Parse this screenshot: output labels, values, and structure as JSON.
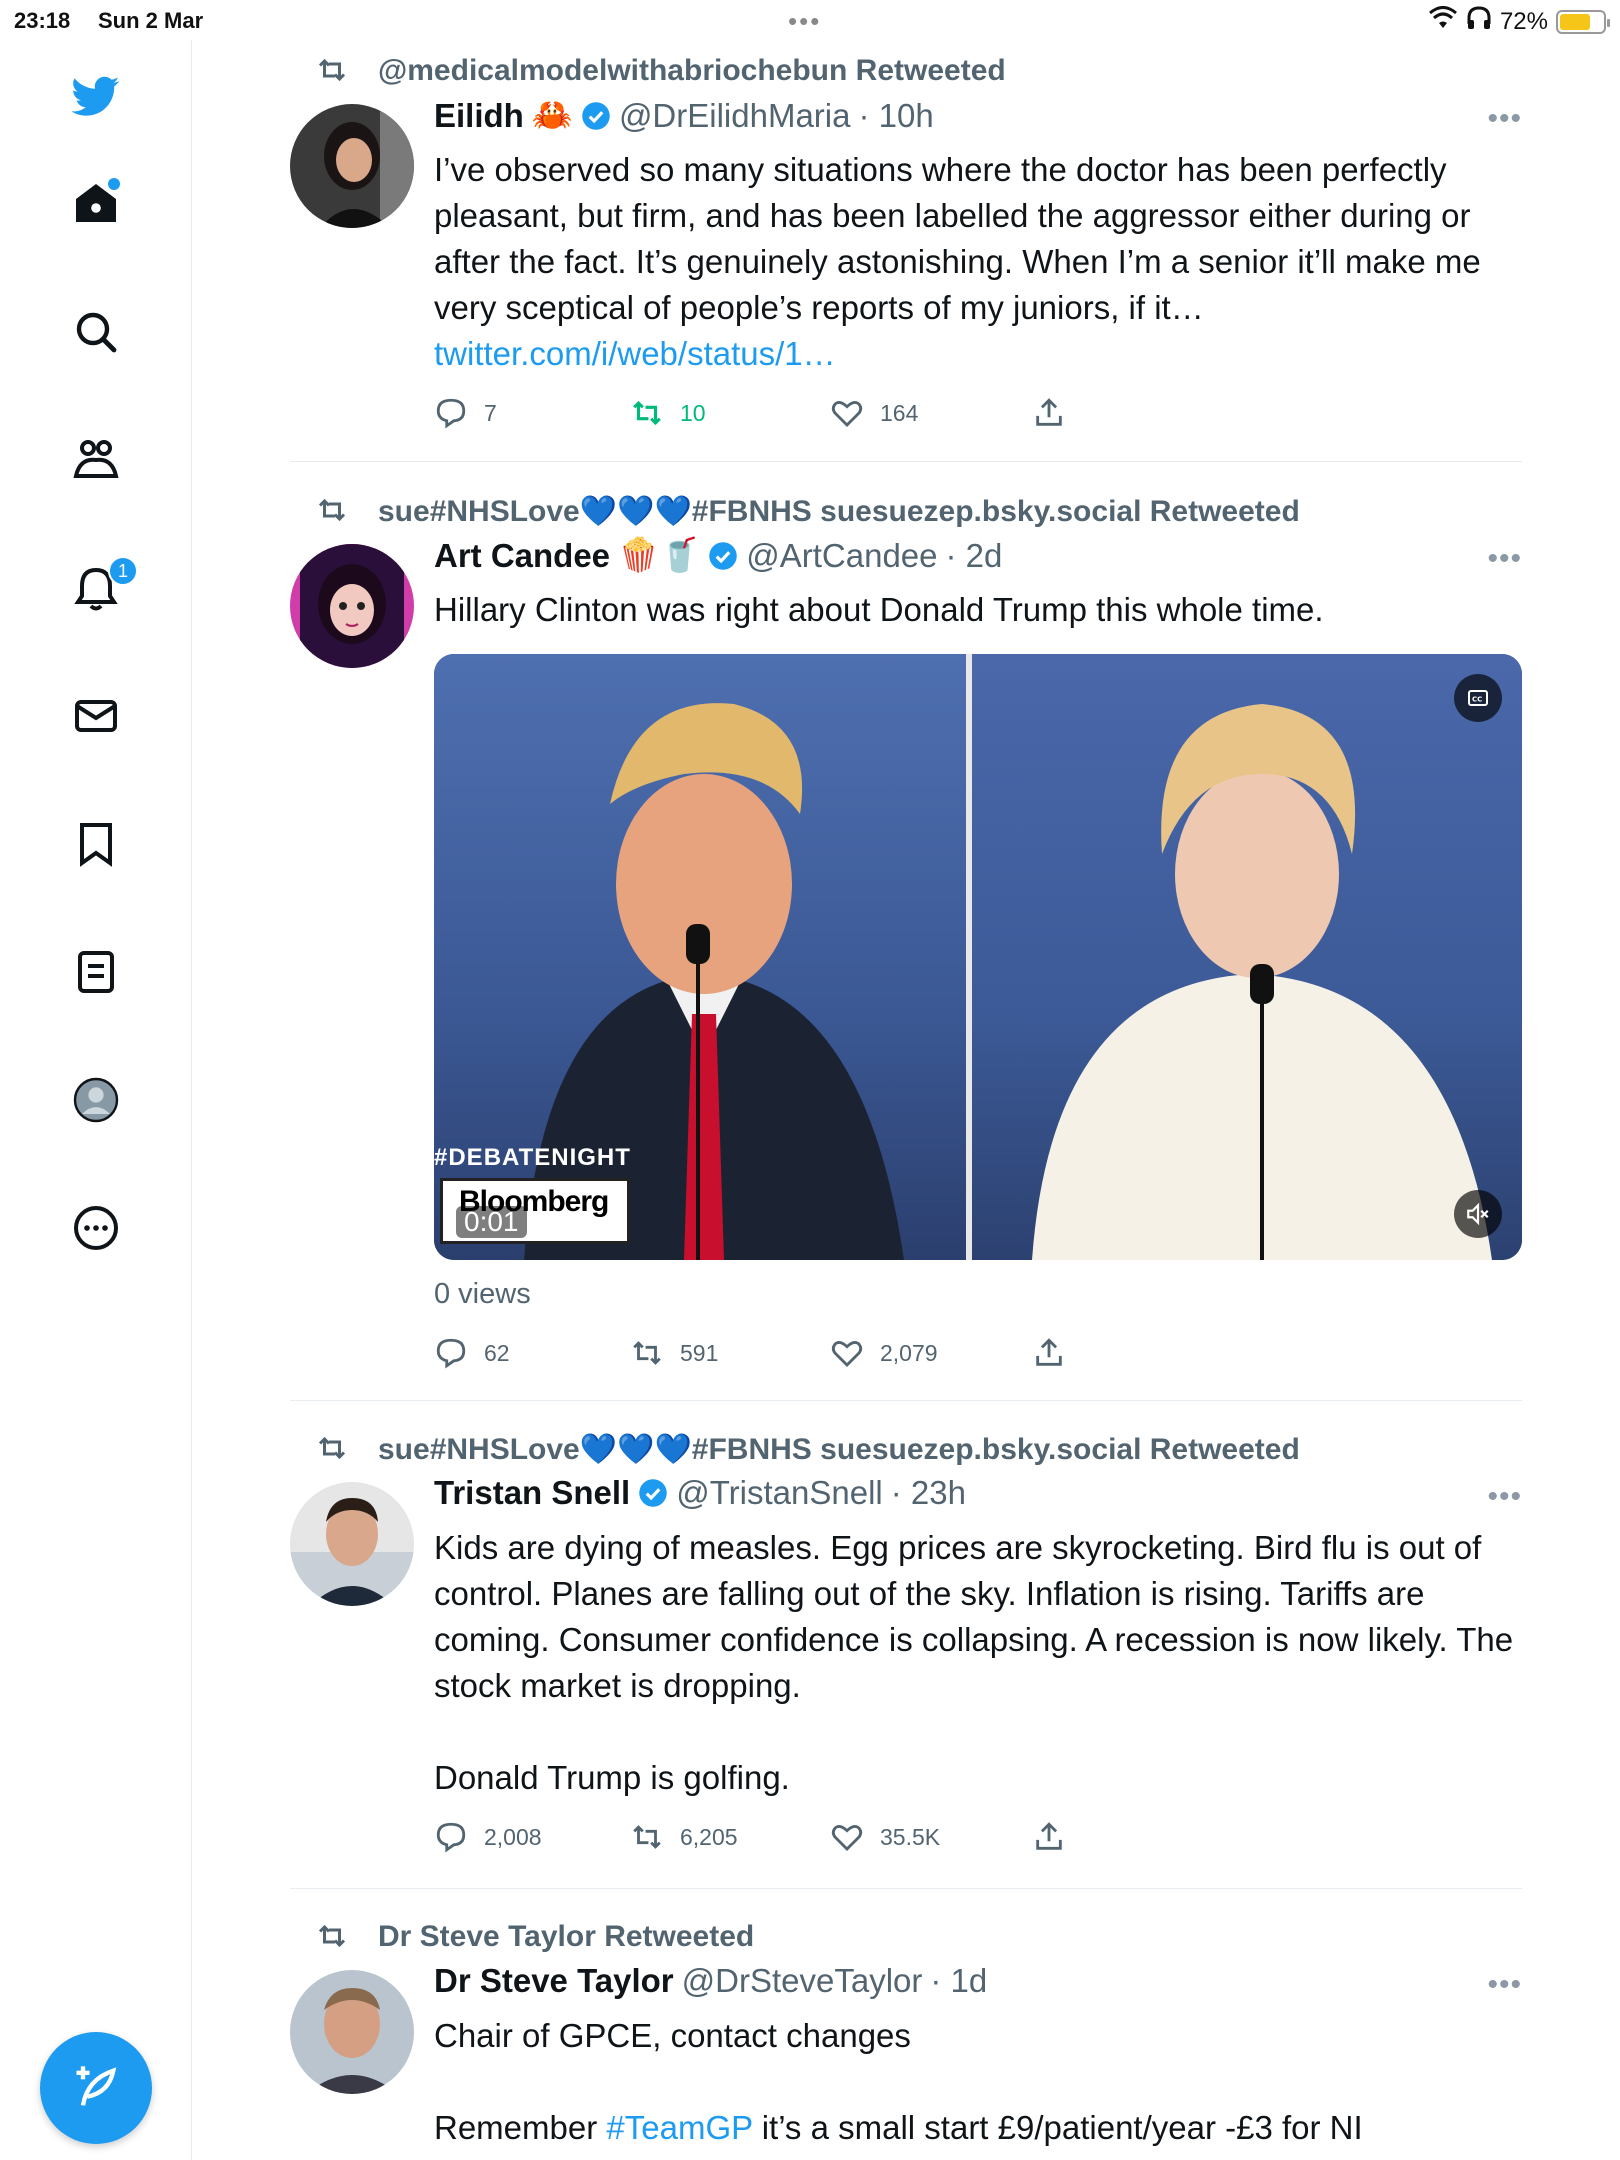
{
  "status_bar": {
    "time": "23:18",
    "date": "Sun 2 Mar",
    "battery": "72%",
    "battery_level": 0.72
  },
  "sidebar": {
    "notification_count": "1"
  },
  "colors": {
    "accent": "#1d9bf0",
    "retweet_active": "#00ba7c",
    "secondary_text": "#536471"
  },
  "tweets": [
    {
      "retweeted_by": "@medicalmodelwithabriochebun Retweeted",
      "name": "Eilidh",
      "emoji": "🦀",
      "handle": "@DrEilidhMaria",
      "time": "· 10h",
      "text": "I’ve observed so many situations where the doctor has been perfectly pleasant, but firm, and has been labelled the aggressor either during or after the fact. It’s genuinely astonishing. When I’m a senior it’ll make me very sceptical of people’s reports of my juniors, if it… ",
      "link": "twitter.com/i/web/status/1…",
      "replies": "7",
      "retweets": "10",
      "likes": "164"
    },
    {
      "retweeted_by": "sue#NHSLove💙💙💙#FBNHS suesuezep.bsky.social Retweeted",
      "name": "Art Candee",
      "emoji": "🍿🥤",
      "handle": "@ArtCandee",
      "time": "· 2d",
      "text": "Hillary Clinton was right about Donald Trump this whole time.",
      "media": {
        "hashtag": "#DEBATENIGHT",
        "logo": "Bloomberg",
        "timer": "0:01"
      },
      "views": "0 views",
      "replies": "62",
      "retweets": "591",
      "likes": "2,079"
    },
    {
      "retweeted_by": "sue#NHSLove💙💙💙#FBNHS suesuezep.bsky.social Retweeted",
      "name": "Tristan Snell",
      "handle": "@TristanSnell",
      "time": "· 23h",
      "text": "Kids are dying of measles. Egg prices are skyrocketing. Bird flu is out of control. Planes are falling out of the sky. Inflation is rising. Tariffs are coming. Consumer confidence is collapsing. A recession is now likely. The stock market is dropping.\n\nDonald Trump is golfing.",
      "replies": "2,008",
      "retweets": "6,205",
      "likes": "35.5K"
    },
    {
      "retweeted_by": "Dr Steve Taylor Retweeted",
      "name": "Dr Steve Taylor",
      "handle": "@DrSteveTaylor",
      "time": "· 1d",
      "text_line1": "Chair of GPCE, contact changes",
      "text_prefix": "Remember ",
      "hashtag": "#TeamGP",
      "text_suffix": " it’s a small start £9/patient/year -£3 for NI"
    }
  ]
}
